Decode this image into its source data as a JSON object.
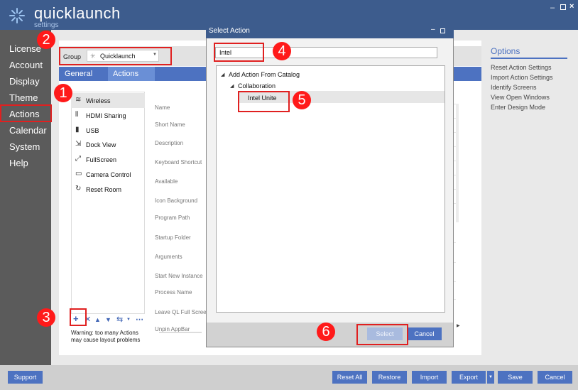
{
  "app": {
    "title": "quicklaunch",
    "subtitle": "settings"
  },
  "window_controls": {
    "minimize": "–",
    "close": "×"
  },
  "nav": {
    "items": [
      "License",
      "Account",
      "Display",
      "Theme",
      "Actions",
      "Calendar",
      "System",
      "Help"
    ]
  },
  "group": {
    "label": "Group",
    "value": "Quicklaunch",
    "icon": "spark-icon"
  },
  "tabs": [
    "General",
    "Actions"
  ],
  "actions": [
    {
      "label": "Wireless",
      "icon": "wifi-icon"
    },
    {
      "label": "HDMI Sharing",
      "icon": "hdmi-icon"
    },
    {
      "label": "USB",
      "icon": "usb-icon"
    },
    {
      "label": "Dock View",
      "icon": "dock-icon"
    },
    {
      "label": "FullScreen",
      "icon": "fullscreen-icon"
    },
    {
      "label": "Camera Control",
      "icon": "camera-icon"
    },
    {
      "label": "Reset Room",
      "icon": "reset-icon"
    }
  ],
  "warning": "Warning: too many Actions may cause layout problems",
  "properties": [
    "Name",
    "Short Name",
    "Description",
    "Keyboard Shortcut",
    "Available",
    "Icon Background",
    "Program Path",
    "Startup Folder",
    "Arguments",
    "Start New Instance",
    "Process Name",
    "Leave QL Full Scree",
    "Unpin AppBar"
  ],
  "property_fragment": "og",
  "options": {
    "title": "Options",
    "links": [
      "Reset Action Settings",
      "Import Action Settings",
      "Identify Screens",
      "View Open Windows",
      "Enter Design Mode"
    ]
  },
  "bottom_buttons": {
    "support": "Support",
    "reset_all": "Reset All",
    "restore": "Restore",
    "import": "Import",
    "export": "Export",
    "save": "Save",
    "cancel": "Cancel"
  },
  "dialog": {
    "title": "Select Action",
    "search_value": "Intel",
    "tree": {
      "root": "Add Action From Catalog",
      "category": "Collaboration",
      "item": "Intel Unite"
    },
    "select_label": "Select",
    "cancel_label": "Cancel"
  },
  "callouts": [
    "1",
    "2",
    "3",
    "4",
    "5",
    "6"
  ],
  "colors": {
    "header": "#3d5c8d",
    "accent": "#4d72c1",
    "nav": "#5b5b5b",
    "callout": "#ff1a1a"
  }
}
